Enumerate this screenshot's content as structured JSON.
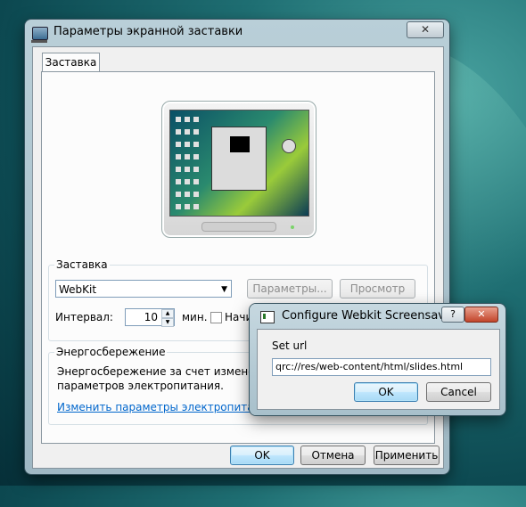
{
  "main_window": {
    "title": "Параметры экранной заставки",
    "close_glyph": "✕",
    "tab_label": "Заставка",
    "screensaver": {
      "group_label": "Заставка",
      "selected": "WebKit",
      "settings_button": "Параметры...",
      "preview_button": "Просмотр",
      "interval_label": "Интервал:",
      "interval_value": "10",
      "interval_unit": "мин.",
      "start_checkbox_label": "Начин"
    },
    "power": {
      "group_label": "Энергосбережение",
      "text_line1": "Энергосбережение за счет изменения я",
      "text_line2": "параметров электропитания.",
      "link": "Изменить параметры электропитания..."
    },
    "buttons": {
      "ok": "OK",
      "cancel": "Отмена",
      "apply": "Применить"
    }
  },
  "config_dialog": {
    "title": "Configure Webkit Screensaver",
    "help_glyph": "?",
    "close_glyph": "✕",
    "url_label": "Set url",
    "url_value": "qrc://res/web-content/html/slides.html",
    "ok": "OK",
    "cancel": "Cancel"
  }
}
